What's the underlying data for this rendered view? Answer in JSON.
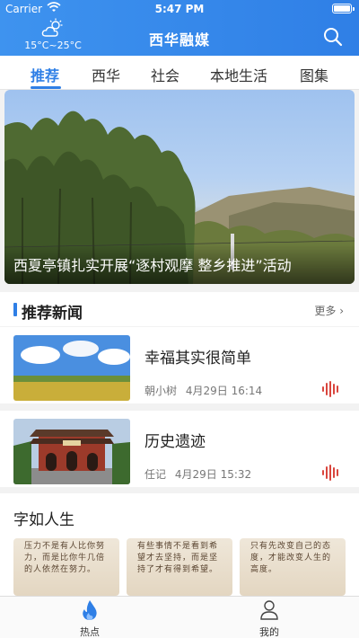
{
  "status_bar": {
    "carrier": "Carrier",
    "time": "5:47 PM"
  },
  "header": {
    "title": "西华融媒",
    "weather_temp": "15°C~25°C"
  },
  "tabs": [
    {
      "label": "推荐",
      "active": true
    },
    {
      "label": "西华"
    },
    {
      "label": "社会"
    },
    {
      "label": "本地生活"
    },
    {
      "label": "图集"
    }
  ],
  "banner": {
    "caption": "西夏亭镇扎实开展“逐村观摩 整乡推进”活动"
  },
  "recommended": {
    "title": "推荐新闻",
    "more": "更多",
    "items": [
      {
        "headline": "幸福其实很简单",
        "author": "朝小树",
        "date": "4月29日 16:14"
      },
      {
        "headline": "历史遗迹",
        "author": "任记",
        "date": "4月29日 15:32"
      }
    ]
  },
  "quote_section": {
    "title": "字如人生",
    "cards": [
      {
        "text": "压力不是有人比你努力，而是比你牛几倍的人依然在努力。"
      },
      {
        "text": "有些事情不是看到希望才去坚持，而是坚持了才有得到希望。"
      },
      {
        "text": "只有先改变自己的态度，才能改变人生的高度。"
      }
    ]
  },
  "bottom_nav": [
    {
      "label": "热点",
      "icon": "flame-icon",
      "color": "#2f7fe6"
    },
    {
      "label": "我的",
      "icon": "user-icon"
    }
  ],
  "colors": {
    "accent": "#2f7fe6",
    "audio": "#d9453d"
  }
}
